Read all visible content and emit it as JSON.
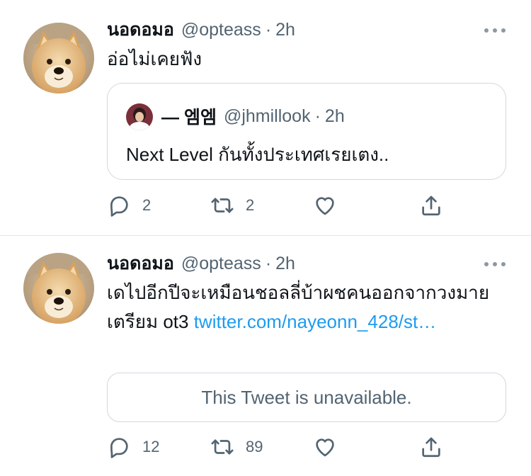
{
  "tweets": [
    {
      "display_name": "นอดอมอ",
      "handle": "@opteass",
      "separator": "·",
      "time": "2h",
      "text": "อ่อไม่เคยฟัง",
      "avatar_icon": "doge-avatar",
      "quote": {
        "display_name": "— 엠엠",
        "handle": "@jhmillook",
        "separator": "·",
        "time": "2h",
        "text": "Next Level กันทั้งประเทศเรยเตง..",
        "avatar_icon": "user-avatar"
      },
      "actions": {
        "replies": "2",
        "retweets": "2",
        "likes": "",
        "share": ""
      }
    },
    {
      "display_name": "นอดอมอ",
      "handle": "@opteass",
      "separator": "·",
      "time": "2h",
      "text": "เดไปอีกปีจะเหมือนชอลลี่บ้าผชคนออกจากวงมายเตรียม ot3 ",
      "link": "twitter.com/nayeonn_428/st…",
      "avatar_icon": "doge-avatar",
      "unavailable_text": "This Tweet is unavailable.",
      "actions": {
        "replies": "12",
        "retweets": "89",
        "likes": "",
        "share": ""
      }
    }
  ],
  "colors": {
    "text_primary": "#0f1419",
    "text_secondary": "#536471",
    "link": "#1d9bf0",
    "border": "#cfd9de",
    "divider": "#e1e6ea"
  },
  "icons": {
    "reply": "speech-bubble-icon",
    "retweet": "retweet-arrows-icon",
    "like": "heart-icon",
    "share": "share-upload-icon",
    "more": "more-dots-icon"
  }
}
